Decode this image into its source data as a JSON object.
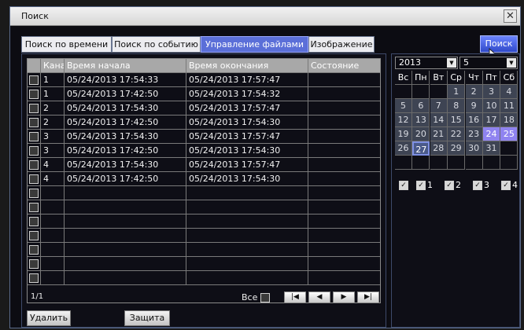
{
  "window": {
    "title": "Поиск",
    "close_glyph": "✕"
  },
  "tabs": [
    {
      "label": "Поиск по времени",
      "active": false
    },
    {
      "label": "Поиск по событию",
      "active": false
    },
    {
      "label": "Управление файлами",
      "active": true
    },
    {
      "label": "Изображение",
      "active": false
    }
  ],
  "search_button": "Поиск",
  "table": {
    "columns": [
      "Канал",
      "Время начала",
      "Время окончания",
      "Состояние"
    ],
    "rows": [
      {
        "channel": "1",
        "start": "05/24/2013 17:54:33",
        "end": "05/24/2013 17:57:47",
        "status": ""
      },
      {
        "channel": "1",
        "start": "05/24/2013 17:42:50",
        "end": "05/24/2013 17:54:32",
        "status": ""
      },
      {
        "channel": "2",
        "start": "05/24/2013 17:54:30",
        "end": "05/24/2013 17:57:47",
        "status": ""
      },
      {
        "channel": "2",
        "start": "05/24/2013 17:42:50",
        "end": "05/24/2013 17:54:30",
        "status": ""
      },
      {
        "channel": "3",
        "start": "05/24/2013 17:54:30",
        "end": "05/24/2013 17:57:47",
        "status": ""
      },
      {
        "channel": "3",
        "start": "05/24/2013 17:42:50",
        "end": "05/24/2013 17:54:30",
        "status": ""
      },
      {
        "channel": "4",
        "start": "05/24/2013 17:54:30",
        "end": "05/24/2013 17:57:47",
        "status": ""
      },
      {
        "channel": "4",
        "start": "05/24/2013 17:42:50",
        "end": "05/24/2013 17:54:30",
        "status": ""
      },
      {
        "channel": "",
        "start": "",
        "end": "",
        "status": ""
      },
      {
        "channel": "",
        "start": "",
        "end": "",
        "status": ""
      },
      {
        "channel": "",
        "start": "",
        "end": "",
        "status": ""
      },
      {
        "channel": "",
        "start": "",
        "end": "",
        "status": ""
      },
      {
        "channel": "",
        "start": "",
        "end": "",
        "status": ""
      },
      {
        "channel": "",
        "start": "",
        "end": "",
        "status": ""
      },
      {
        "channel": "",
        "start": "",
        "end": "",
        "status": ""
      }
    ]
  },
  "pager": {
    "page": "1/1",
    "all_label": "Все",
    "buttons": [
      {
        "name": "first-page-button",
        "icon": "first-page-icon",
        "glyph": "|◀"
      },
      {
        "name": "prev-page-button",
        "icon": "prev-page-icon",
        "glyph": "◀"
      },
      {
        "name": "next-page-button",
        "icon": "next-page-icon",
        "glyph": "▶"
      },
      {
        "name": "last-page-button",
        "icon": "last-page-icon",
        "glyph": "▶|"
      }
    ]
  },
  "actions": {
    "delete": "Удалить",
    "protect": "Защита"
  },
  "calendar": {
    "year": "2013",
    "month": "5",
    "dropdown_glyph": "▼",
    "weekdays": [
      "Вс",
      "Пн",
      "Вт",
      "Ср",
      "Чт",
      "Пт",
      "Сб"
    ],
    "weeks": [
      [
        "",
        "",
        "",
        "1",
        "2",
        "3",
        "4"
      ],
      [
        "5",
        "6",
        "7",
        "8",
        "9",
        "10",
        "11"
      ],
      [
        "12",
        "13",
        "14",
        "15",
        "16",
        "17",
        "18"
      ],
      [
        "19",
        "20",
        "21",
        "22",
        "23",
        "24",
        "25"
      ],
      [
        "26",
        "27",
        "28",
        "29",
        "30",
        "31",
        ""
      ],
      [
        "",
        "",
        "",
        "",
        "",
        "",
        ""
      ]
    ],
    "highlighted_days": [
      "24",
      "25"
    ],
    "today": "27",
    "colors": {
      "day_bg": "#3e4453",
      "highlight": "#8f83f0",
      "today_border": "#7d8fe2"
    }
  },
  "channels": {
    "check_glyph": "✓",
    "items": [
      {
        "label": "",
        "checked": true
      },
      {
        "label": "1",
        "checked": true
      },
      {
        "label": "2",
        "checked": true
      },
      {
        "label": "3",
        "checked": true
      },
      {
        "label": "4",
        "checked": true
      }
    ]
  }
}
